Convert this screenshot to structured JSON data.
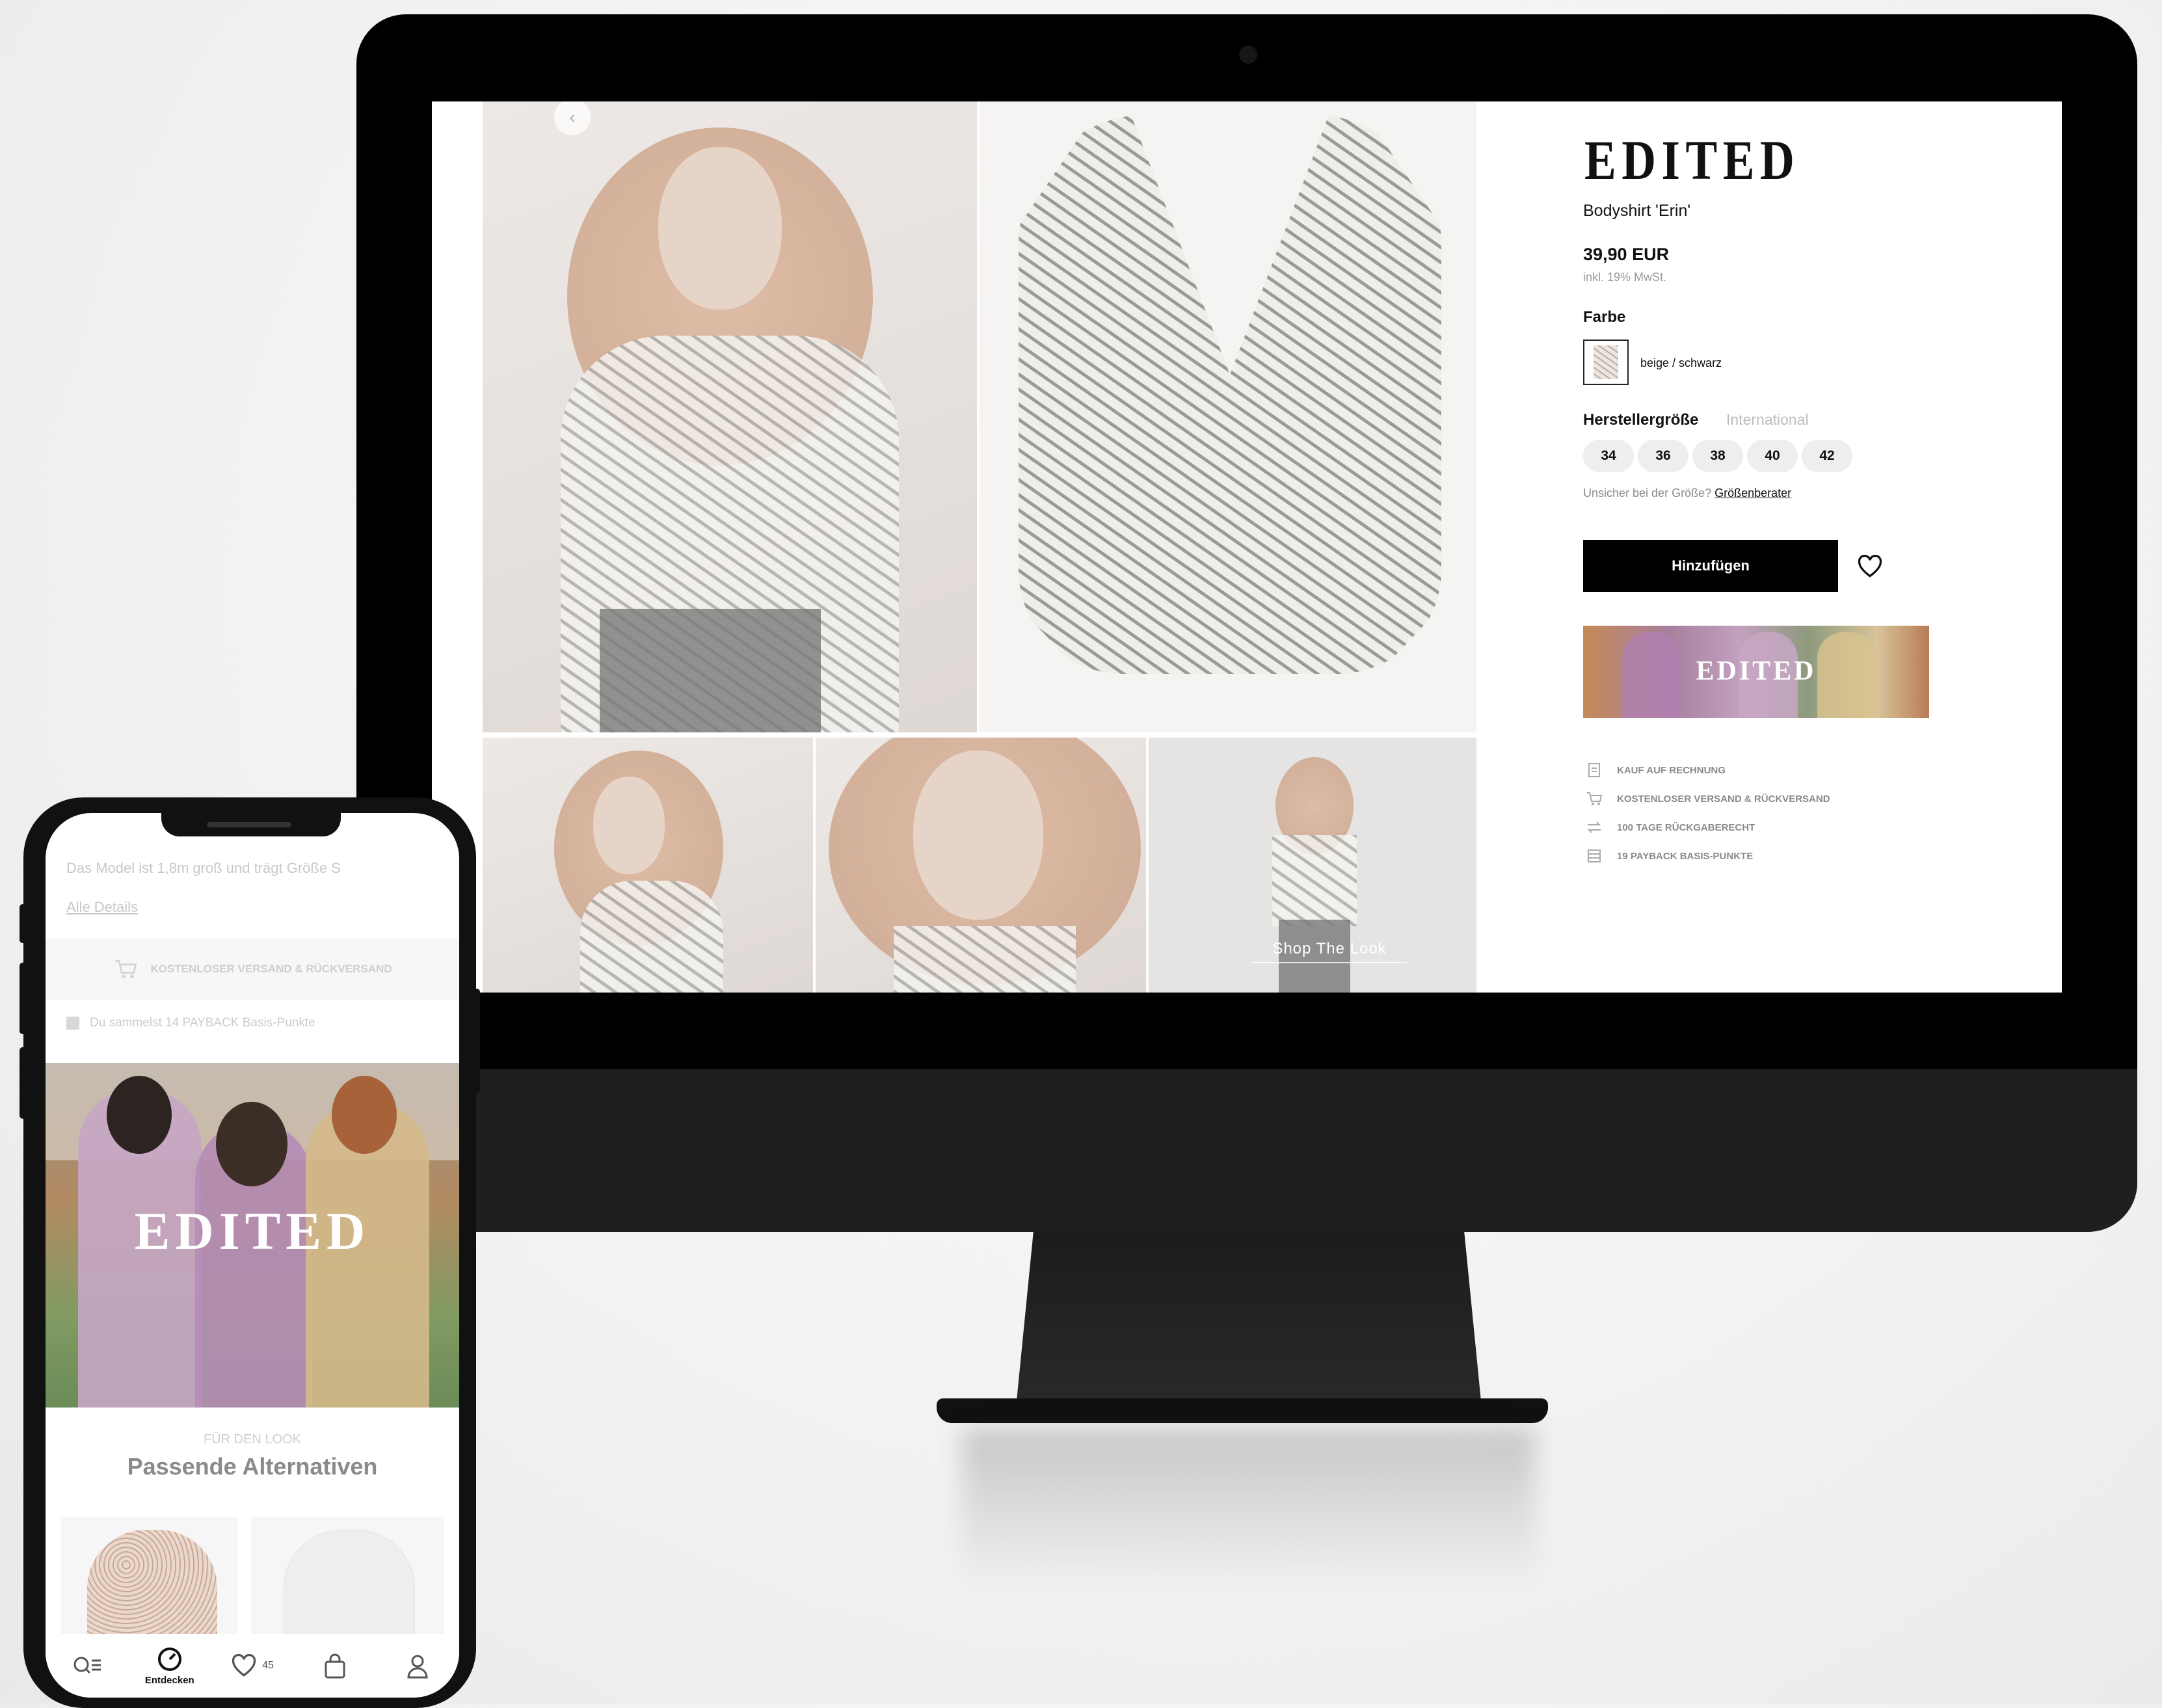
{
  "desktop": {
    "gallery": {
      "back_icon": "chevron-left-icon",
      "shop_the_look": "Shop The Look"
    },
    "product": {
      "brand": "EDITED",
      "name": "Bodyshirt 'Erin'",
      "price": "39,90 EUR",
      "tax_note": "inkl. 19% MwSt.",
      "color_label": "Farbe",
      "color_name": "beige / schwarz",
      "size_label": "Herstellergröße",
      "size_tab_international": "International",
      "sizes": [
        "34",
        "36",
        "38",
        "40",
        "42"
      ],
      "size_hint": "Unsicher bei der Größe?",
      "size_advisor": "Größenberater",
      "add_button": "Hinzufügen",
      "wishlist_icon": "heart-icon"
    },
    "promo_banner": {
      "word": "EDITED"
    },
    "benefits": [
      {
        "icon": "invoice-icon",
        "label": "KAUF AUF RECHNUNG"
      },
      {
        "icon": "cart-icon",
        "label": "KOSTENLOSER VERSAND & RÜCKVERSAND"
      },
      {
        "icon": "swap-arrows-icon",
        "label": "100 TAGE RÜCKGABERECHT"
      },
      {
        "icon": "payback-icon",
        "label": "19 PAYBACK BASIS-PUNKTE"
      }
    ]
  },
  "mobile": {
    "model_info": "Das Model ist 1,8m groß und trägt Größe S",
    "all_details": "Alle Details",
    "shipping": "KOSTENLOSER VERSAND & RÜCKVERSAND",
    "payback": "Du sammelst 14 PAYBACK Basis-Punkte",
    "hero_word": "EDITED",
    "look_kicker": "FÜR DEN LOOK",
    "look_title": "Passende Alternativen",
    "tabbar": {
      "discover_label": "Entdecken",
      "wishlist_count": "45"
    }
  },
  "colors": {
    "accent": "#000000",
    "chip_bg": "#eeeeee",
    "muted": "#9a9a9a"
  }
}
